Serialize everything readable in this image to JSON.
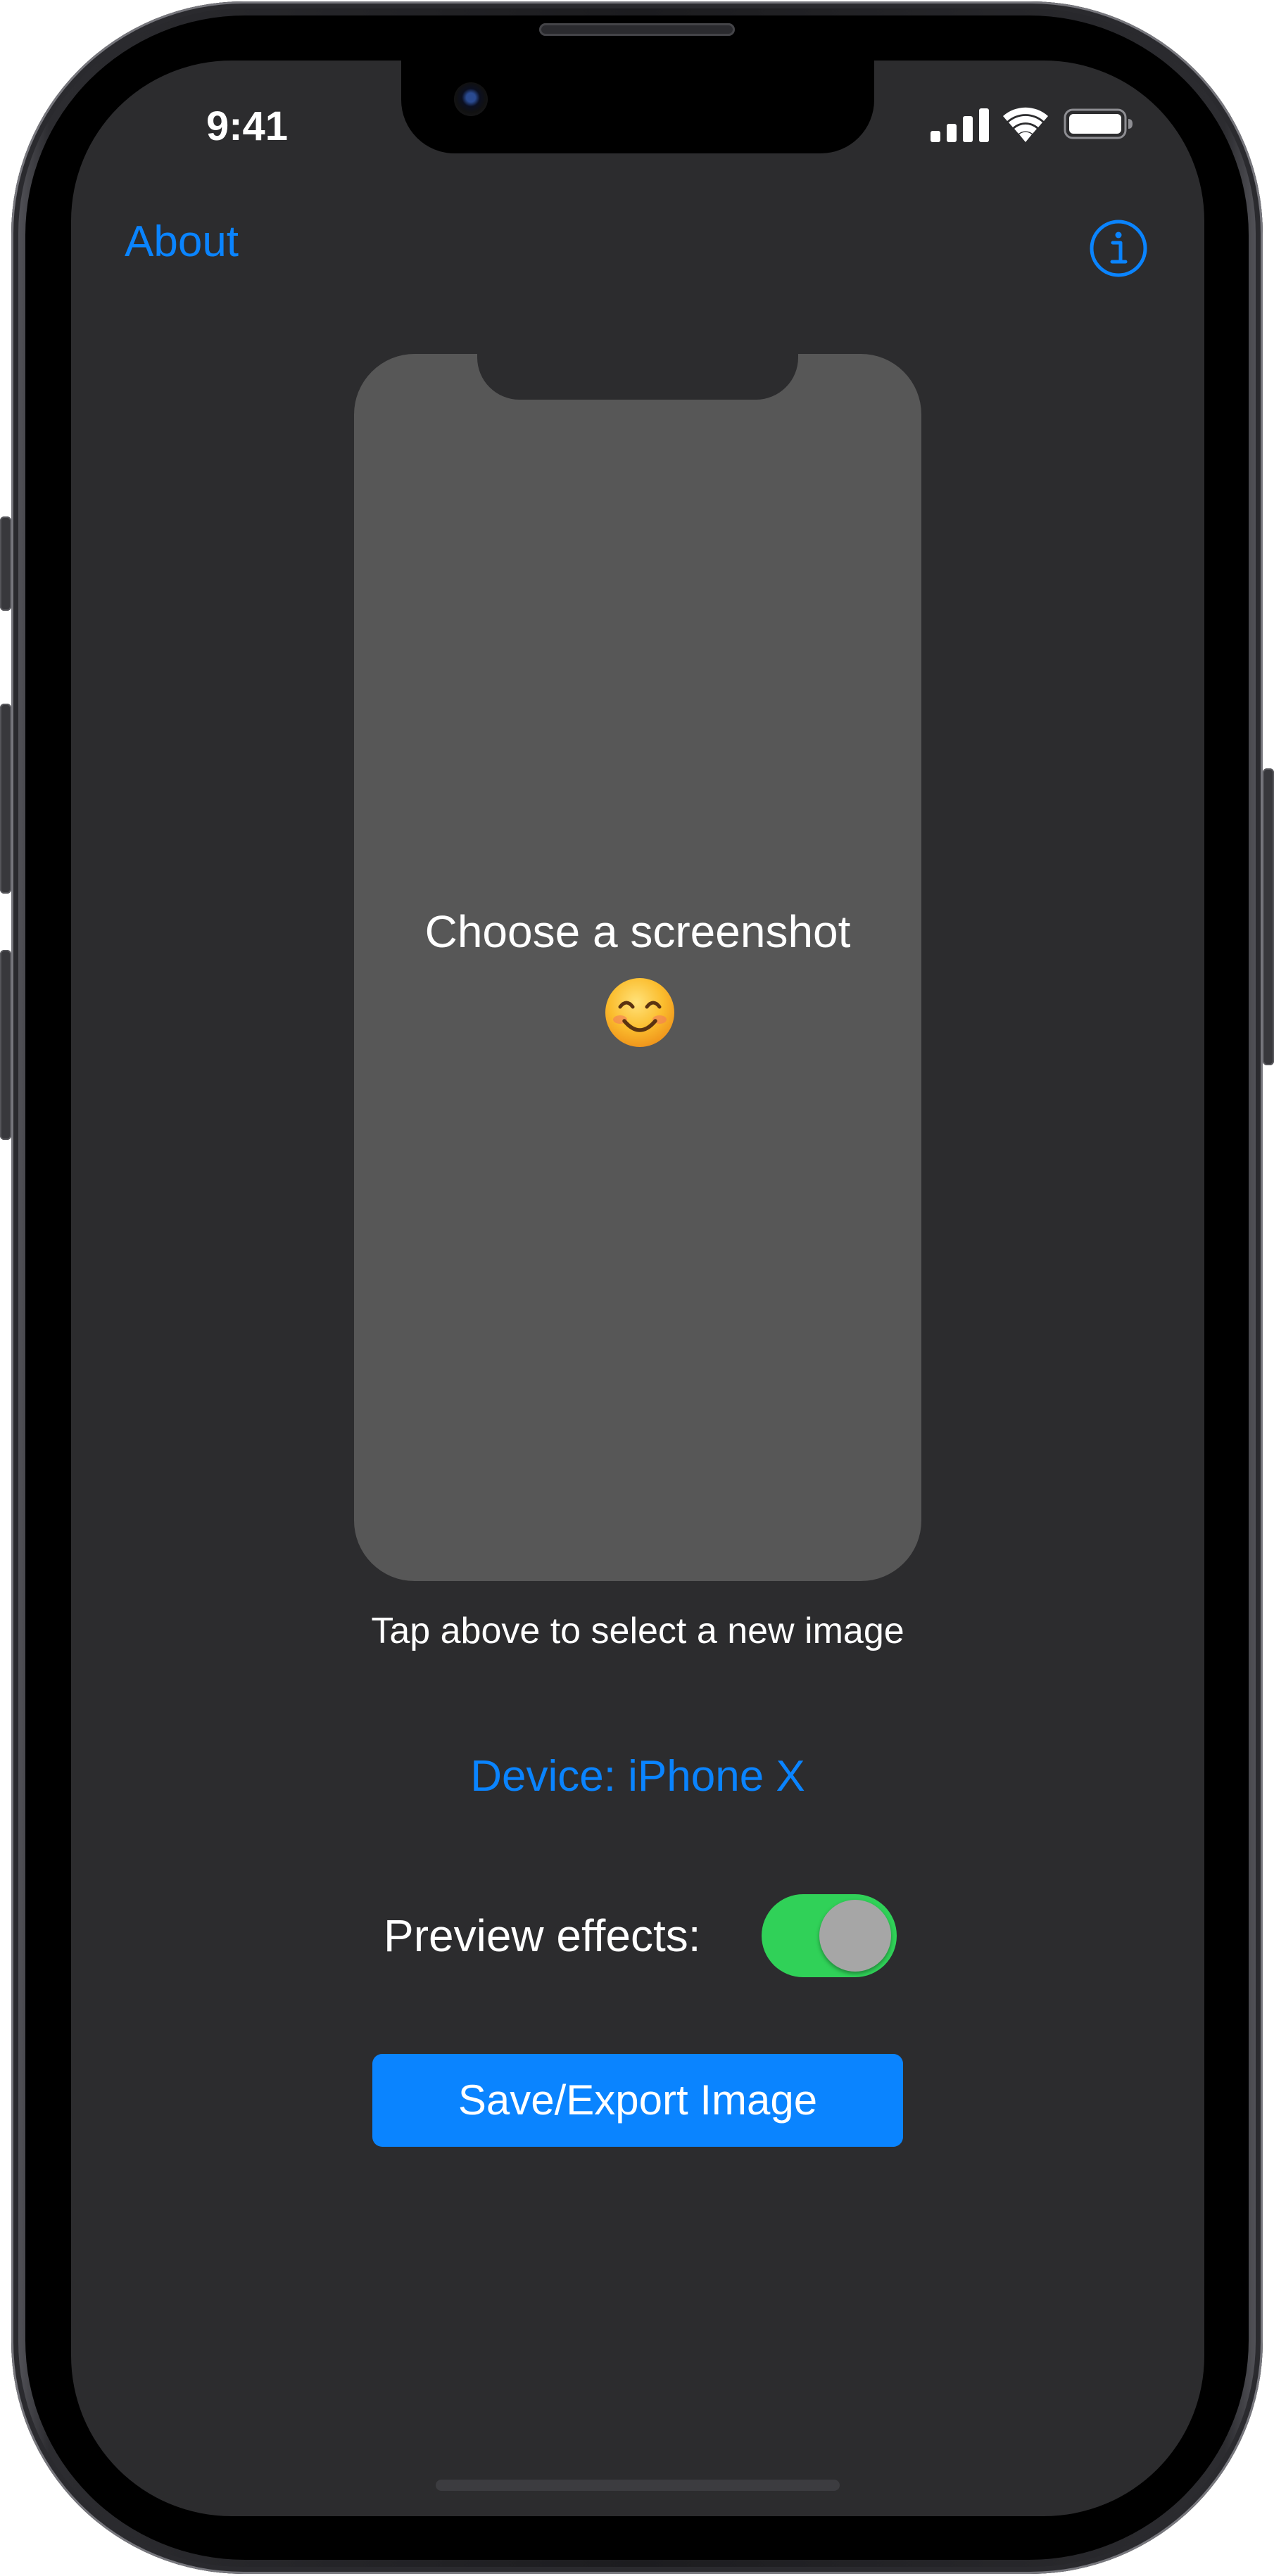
{
  "status_bar": {
    "time": "9:41",
    "icons": [
      "cellular-signal-icon",
      "wifi-icon",
      "battery-icon"
    ]
  },
  "nav": {
    "about_label": "About",
    "info_icon": "info-circle-icon"
  },
  "preview": {
    "title": "Choose a screenshot",
    "emoji_icon": "smiling-face-emoji"
  },
  "hint": "Tap above to select a new image",
  "device": {
    "label": "Device: iPhone X"
  },
  "preview_effects": {
    "label": "Preview effects:",
    "enabled": true
  },
  "save_button": {
    "label": "Save/Export Image"
  },
  "colors": {
    "background": "#2c2c2e",
    "accent": "#0a84ff",
    "toggle_on": "#30d158",
    "preview_fill": "#575757",
    "text": "#ffffff"
  }
}
